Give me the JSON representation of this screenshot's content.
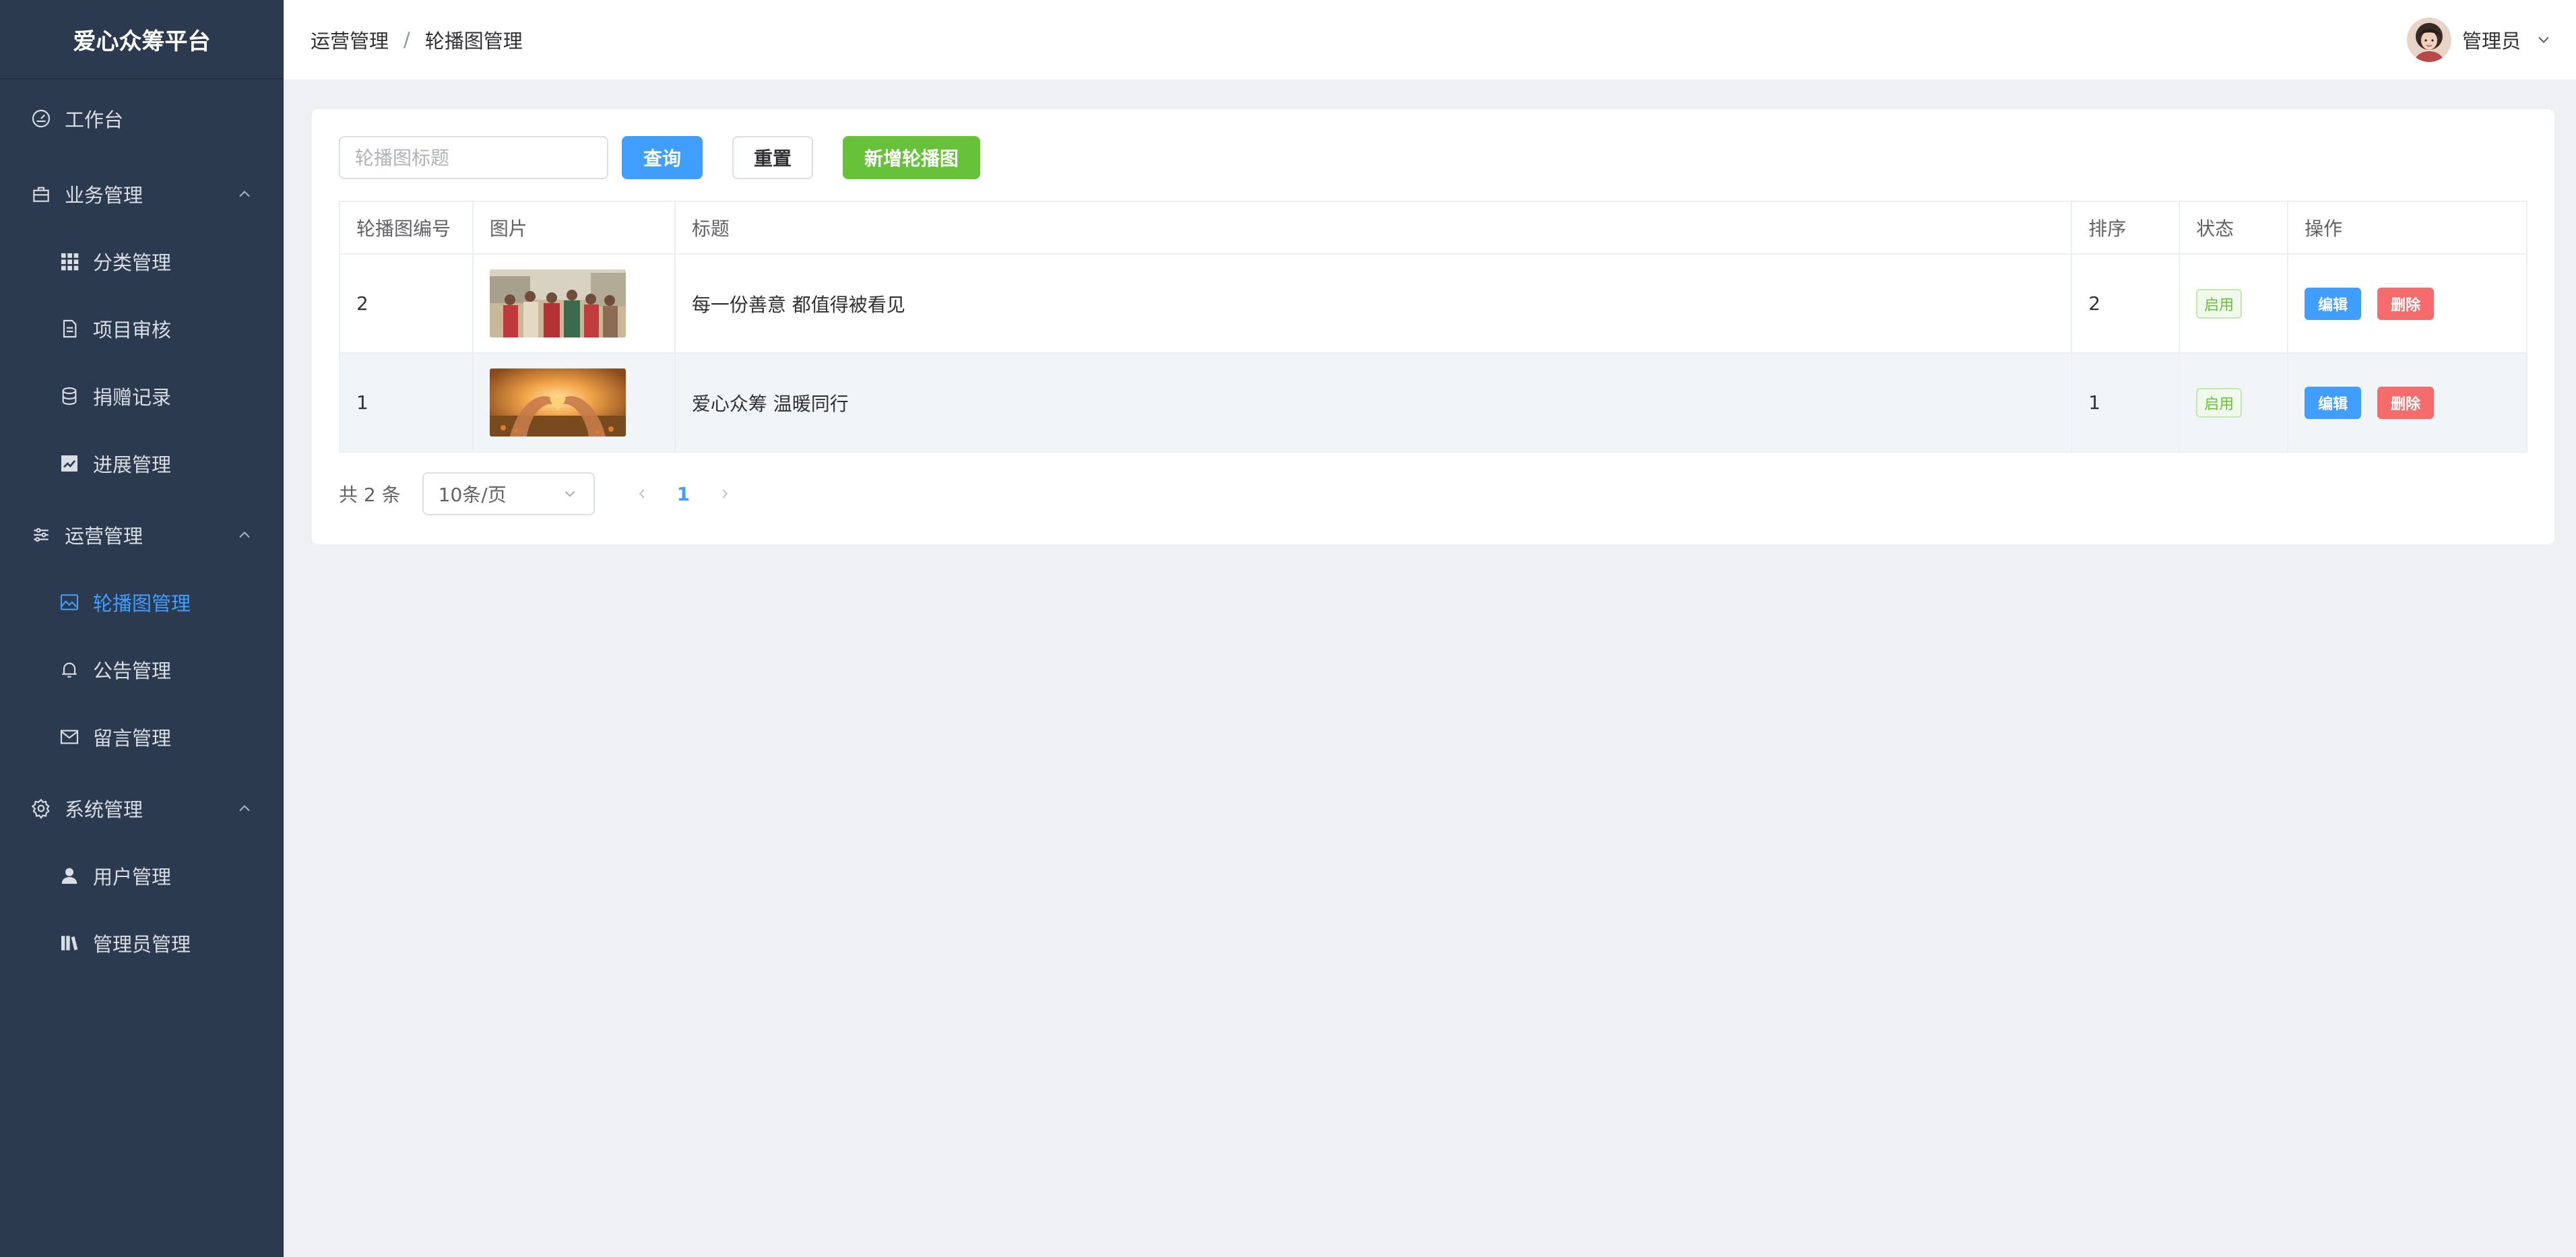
{
  "app": {
    "title": "爱心众筹平台"
  },
  "sidebar": {
    "items": [
      {
        "label": "工作台",
        "icon": "dashboard-icon"
      },
      {
        "label": "业务管理",
        "icon": "business-icon",
        "expanded": true
      },
      {
        "label": "分类管理",
        "icon": "grid-icon"
      },
      {
        "label": "项目审核",
        "icon": "document-icon"
      },
      {
        "label": "捐赠记录",
        "icon": "database-icon"
      },
      {
        "label": "进展管理",
        "icon": "chart-icon"
      },
      {
        "label": "运营管理",
        "icon": "sliders-icon",
        "expanded": true
      },
      {
        "label": "轮播图管理",
        "icon": "picture-icon",
        "active": true
      },
      {
        "label": "公告管理",
        "icon": "bell-icon"
      },
      {
        "label": "留言管理",
        "icon": "message-icon"
      },
      {
        "label": "系统管理",
        "icon": "settings-icon",
        "expanded": true
      },
      {
        "label": "用户管理",
        "icon": "user-icon"
      },
      {
        "label": "管理员管理",
        "icon": "books-icon"
      }
    ]
  },
  "header": {
    "breadcrumb": [
      "运营管理",
      "轮播图管理"
    ],
    "breadcrumb_separator": "/",
    "user_name": "管理员"
  },
  "toolbar": {
    "search_placeholder": "轮播图标题",
    "query_label": "查询",
    "reset_label": "重置",
    "add_label": "新增轮播图"
  },
  "table": {
    "columns": [
      "轮播图编号",
      "图片",
      "标题",
      "排序",
      "状态",
      "操作"
    ],
    "rows": [
      {
        "id": "2",
        "image": "people-group-photo",
        "title": "每一份善意 都值得被看见",
        "sort": "2",
        "status": "启用",
        "edit": "编辑",
        "delete": "删除"
      },
      {
        "id": "1",
        "image": "heart-hands-photo",
        "title": "爱心众筹 温暖同行",
        "sort": "1",
        "status": "启用",
        "edit": "编辑",
        "delete": "删除"
      }
    ]
  },
  "pagination": {
    "total_text": "共 2 条",
    "page_size": "10条/页",
    "current_page": "1"
  },
  "colors": {
    "sidebar_bg": "#2b3a4e",
    "primary": "#409eff",
    "success": "#67c23a",
    "danger": "#f56c6c",
    "page_bg": "#eef0f3"
  }
}
